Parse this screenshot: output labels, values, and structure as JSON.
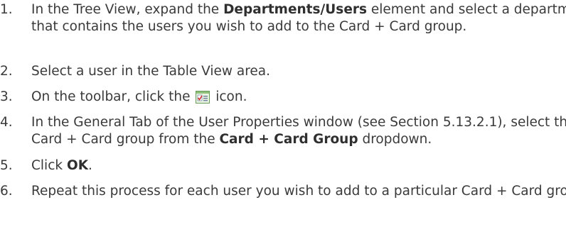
{
  "steps": [
    {
      "number": "1.",
      "parts": [
        "In the Tree View, expand the ",
        "Departments/Users",
        " element and select a department that contains the users you wish to add to the Card + Card group."
      ]
    },
    {
      "number": "2.",
      "text": "Select a user in the Table View area."
    },
    {
      "number": "3.",
      "before": "On the toolbar, click the",
      "icon": "user-properties-icon",
      "after": "icon."
    },
    {
      "number": "4.",
      "parts": [
        "In the General Tab of the User Properties window (see Section 5.13.2.1), select the Card + Card group from the ",
        "Card + Card Group",
        " dropdown."
      ]
    },
    {
      "number": "5.",
      "parts": [
        "Click ",
        "OK",
        "."
      ]
    },
    {
      "number": "6.",
      "text": "Repeat this process for each user you wish to add to a particular Card + Card group."
    }
  ]
}
